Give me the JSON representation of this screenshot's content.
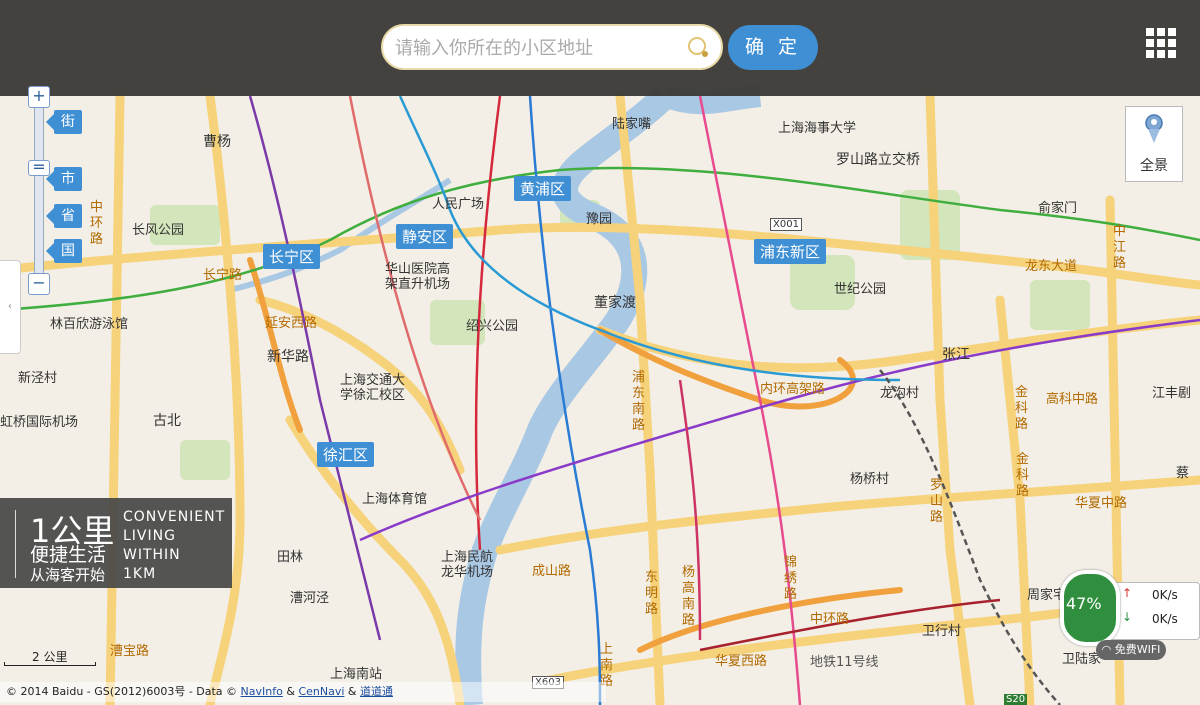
{
  "search": {
    "placeholder": "请输入你所在的小区地址"
  },
  "confirm_label": "确 定",
  "map_levels": [
    "街",
    "市",
    "省",
    "国"
  ],
  "zoom_plus": "+",
  "zoom_minus": "−",
  "panorama_label": "全景",
  "side_tab_glyph": "‹",
  "district_badges": [
    "黄浦区",
    "静安区",
    "长宁区",
    "浦东新区",
    "徐汇区"
  ],
  "place_labels": [
    "陆家嘴",
    "上海海事大学",
    "罗山路立交桥",
    "曹杨",
    "人民广场",
    "豫园",
    "长风公园",
    "华山医院高架直升机场",
    "世纪公园",
    "俞家门",
    "长宁路",
    "延安西路",
    "林百欣游泳馆",
    "绍兴公园",
    "董家渡",
    "中江路",
    "龙东大道",
    "新华路",
    "张江",
    "新泾村",
    "上海交通大学徐汇校区",
    "龙沟村",
    "江丰剧",
    "虹桥国际机场",
    "古北",
    "高科中路",
    "金科路",
    "杨桥村",
    "上海体育馆",
    "成山路",
    "锦绣路",
    "华夏中路",
    "金科路",
    "蔡",
    "田林",
    "上海民航龙华机场",
    "东明路",
    "杨高南路",
    "中环路",
    "漕河泾",
    "漕宝路",
    "上海南站",
    "上南路",
    "华夏西路",
    "地铁11号线",
    "卫行村",
    "周家宅",
    "卫陆家",
    "罗山路",
    "浦东南路",
    "内环高架路",
    "中环路",
    "X001",
    "X603",
    "S20"
  ],
  "promo": {
    "big": "1公里",
    "mid": "便捷生活",
    "small": "从海客开始",
    "en_lines": [
      "CONVENIENT",
      "LIVING",
      "WITHIN",
      "1KM"
    ]
  },
  "wifi": {
    "percent": "47%",
    "up": "0K/s",
    "down": "0K/s",
    "label": "免费WIFI"
  },
  "scale": {
    "label": "2 公里"
  },
  "copyright": {
    "prefix": "© 2014 Baidu - GS(2012)6003号 - Data © ",
    "link1": "NavInfo",
    "sep": " & ",
    "link2": "CenNavi",
    "sep2": " & ",
    "link3": "道道通"
  },
  "colors": {
    "topbar": "#3b3a37",
    "accent": "#3f8fd4",
    "map_bg": "#f3efe6",
    "water": "#a9c8e4",
    "road": "#f6d27a",
    "park": "#cfe3b6"
  }
}
